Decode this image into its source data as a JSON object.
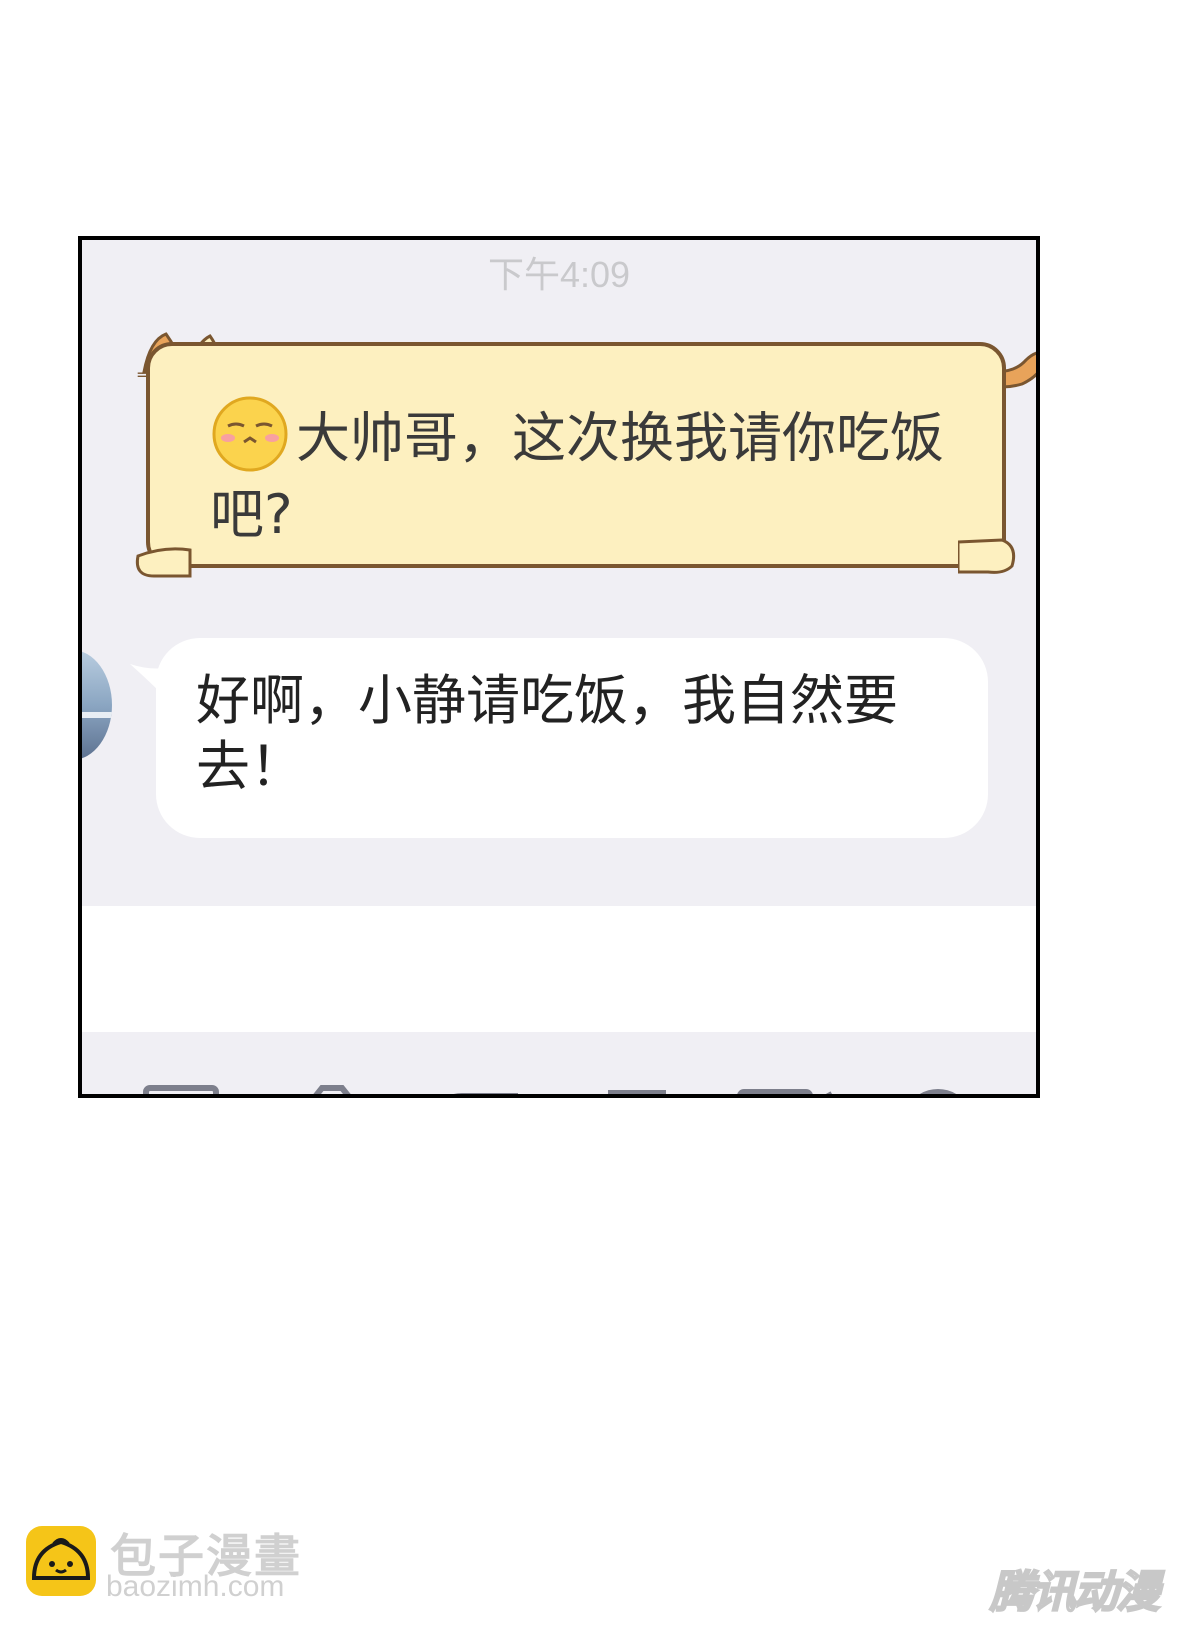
{
  "chat": {
    "timestamp": "下午4:09",
    "messages": [
      {
        "sender": "me",
        "style": "cat-sticker-bubble",
        "emoji": "blushing-face-icon",
        "text": "大帅哥，这次换我请你吃饭吧?"
      },
      {
        "sender": "other",
        "style": "white-bubble",
        "text": "好啊，小静请吃饭，我自然要去！"
      }
    ]
  },
  "toolbar": {
    "icons": [
      "image-icon",
      "camera-icon",
      "red-packet-icon",
      "sticker-icon",
      "video-icon",
      "more-icon"
    ]
  },
  "watermarks": {
    "left_title": "包子漫畫",
    "left_url": "baozimh.com",
    "right_text": "腾讯动漫"
  },
  "colors": {
    "chat_background": "#f0eff4",
    "cat_bubble_fill": "#fdf0c0",
    "cat_bubble_border": "#7a5630",
    "timestamp": "#c9c9cc",
    "logo_yellow": "#f5c518"
  }
}
